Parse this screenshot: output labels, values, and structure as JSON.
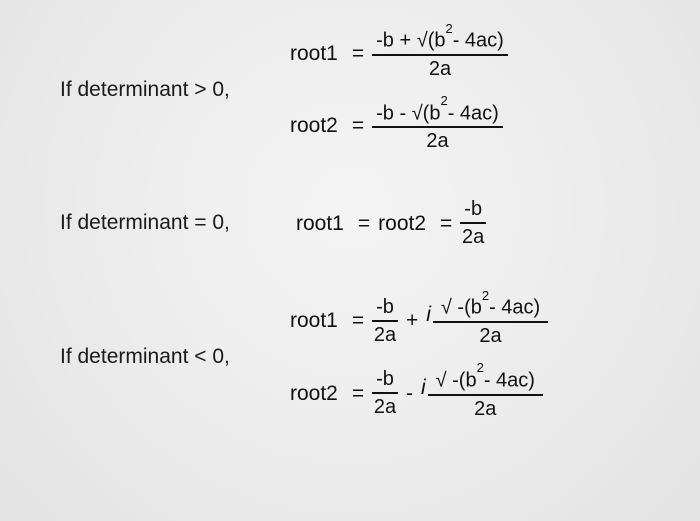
{
  "case_positive": {
    "condition": "If determinant > 0,",
    "root1": {
      "label": "root1",
      "eq": "=",
      "frac": {
        "num_html": "-b + √(b<sup>2</sup>- 4ac)",
        "den": "2a"
      }
    },
    "root2": {
      "label": "root2",
      "eq": "=",
      "frac": {
        "num_html": "-b - √(b<sup>2</sup>- 4ac)",
        "den": "2a"
      }
    }
  },
  "case_zero": {
    "condition": "If determinant = 0,",
    "root": {
      "label1": "root1",
      "eq1": "=",
      "label2": "root2",
      "eq2": "=",
      "frac": {
        "num": "-b",
        "den": "2a"
      }
    }
  },
  "case_negative": {
    "condition": "If determinant < 0,",
    "root1": {
      "label": "root1",
      "eq": "=",
      "frac1": {
        "num": "-b",
        "den": "2a"
      },
      "op": "+",
      "i": "i",
      "frac2": {
        "num_html": "√ -(b<sup>2</sup>- 4ac)",
        "den": "2a"
      }
    },
    "root2": {
      "label": "root2",
      "eq": "=",
      "frac1": {
        "num": "-b",
        "den": "2a"
      },
      "op": "-",
      "i": "i",
      "frac2": {
        "num_html": "√ -(b<sup>2</sup>- 4ac)",
        "den": "2a"
      }
    }
  }
}
